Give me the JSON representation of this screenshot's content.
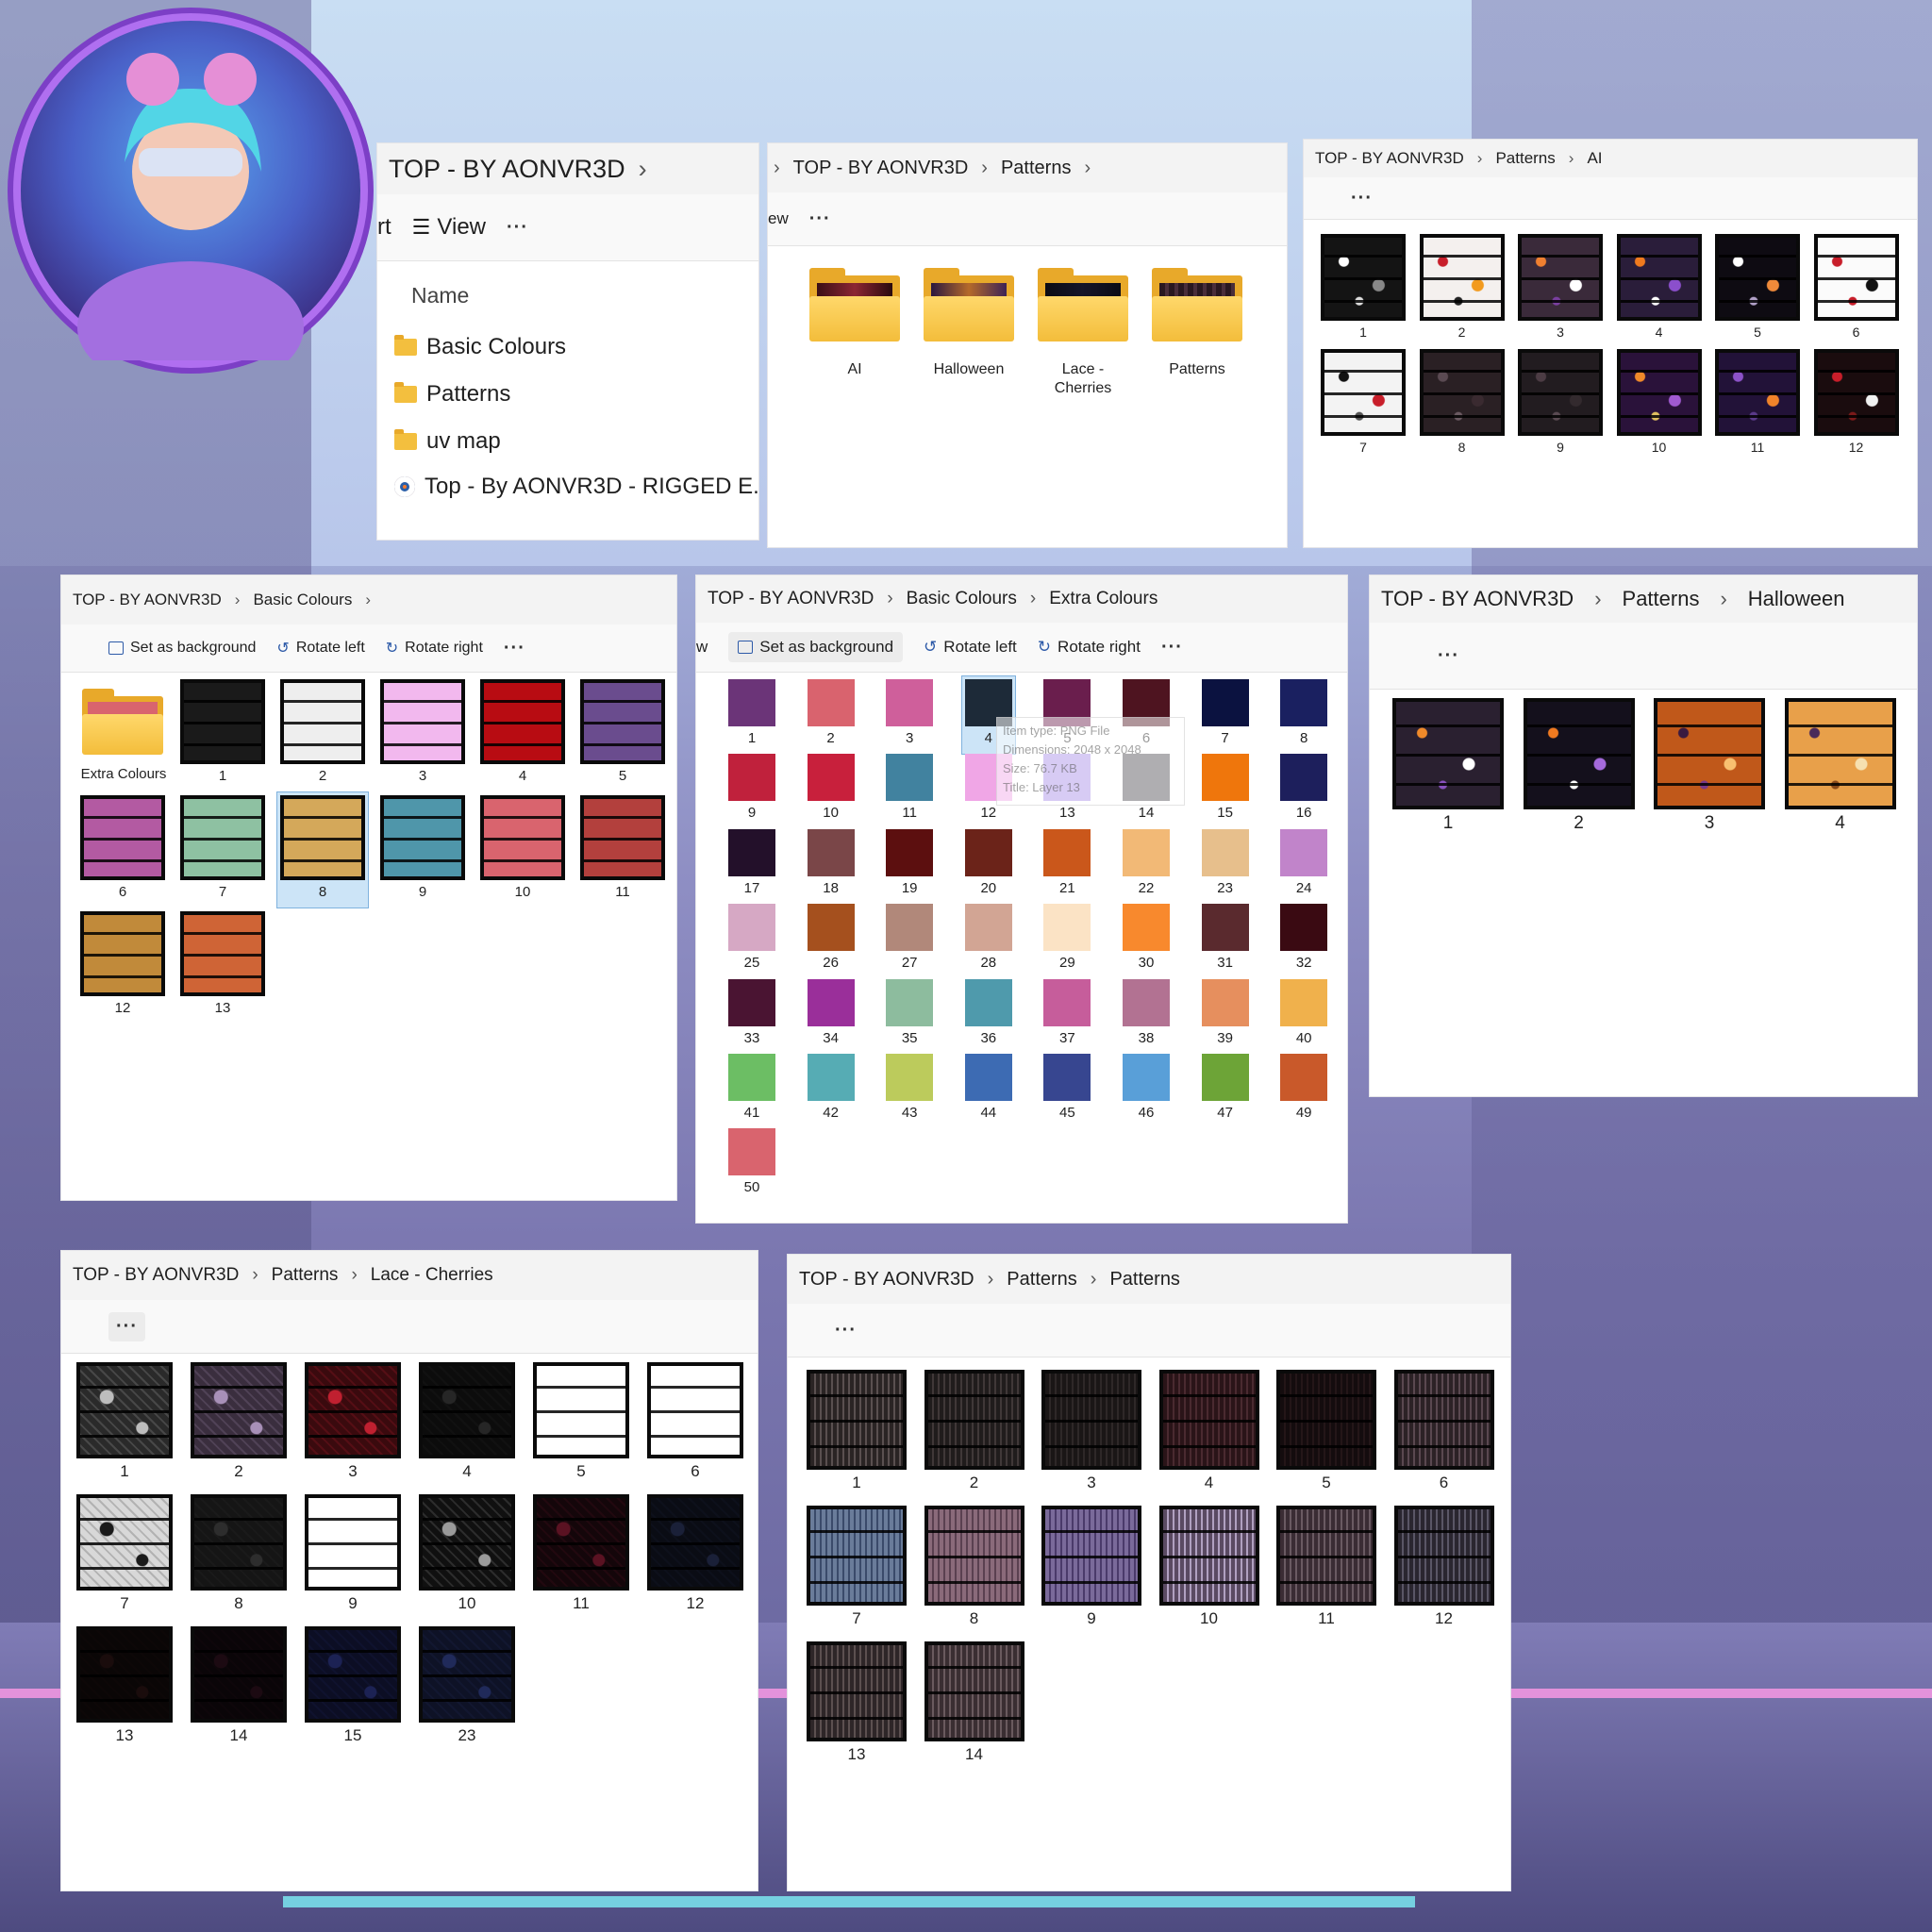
{
  "colors": {
    "basic": [
      "#1a1a1a",
      "#eeeeee",
      "#f2b8ee",
      "#b80c12",
      "#6a4c8e",
      "#b35aa2",
      "#8ec1a2",
      "#d4a85a",
      "#4f96aa",
      "#d9646e",
      "#b3403d",
      "#c18a3a",
      "#cf6436"
    ],
    "extra": [
      "#6b3478",
      "#d9636e",
      "#cf5f9b",
      "#1d2a38",
      "#6a1e4d",
      "#4e1420",
      "#0b1240",
      "#1a2060",
      "#c0213c",
      "#c8203c",
      "#41829f",
      "#f0a6e6",
      "#a68ce6",
      "#4f4c52",
      "#ef760c",
      "#1d1f5c",
      "#23102a",
      "#7a4648",
      "#5c0f0f",
      "#6b2319",
      "#ca571b",
      "#f2b976",
      "#e7bf8c",
      "#c184ca",
      "#d6a8c4",
      "#a5501e",
      "#b1887a",
      "#d2a594",
      "#fbe3c5",
      "#f8892d",
      "#5a2a2e",
      "#3a0a12",
      "#4a1432",
      "#9a2f9a",
      "#8dbc9e",
      "#4f9aac",
      "#c65d9b",
      "#b27292",
      "#e68f5e",
      "#f0b14c",
      "#6cbe64",
      "#56acb4",
      "#bccb5c",
      "#3d6bb3",
      "#374690",
      "#599fd8",
      "#6da437",
      "#c9592a",
      "#d9646e"
    ]
  },
  "root_window": {
    "breadcrumb": [
      "TOP - BY AONVR3D"
    ],
    "toolbar": {
      "sort": "rt",
      "view": "View",
      "more": "···"
    },
    "column_header": "Name",
    "items": [
      "Basic Colours",
      "Patterns",
      "uv map",
      "Top - By AONVR3D - RIGGED E..."
    ]
  },
  "patterns_window": {
    "breadcrumb": [
      "TOP - BY AONVR3D",
      "Patterns"
    ],
    "toolbar": {
      "view_partial": "ew",
      "more": "···"
    },
    "folders": [
      "AI",
      "Halloween",
      "Lace -\nCherries",
      "Patterns"
    ]
  },
  "ai_window": {
    "breadcrumb": [
      "TOP - BY AONVR3D",
      "Patterns",
      "AI"
    ],
    "toolbar": {
      "more": "···"
    },
    "labels": [
      "1",
      "2",
      "3",
      "4",
      "5",
      "6",
      "7",
      "8",
      "9",
      "10",
      "11",
      "12"
    ]
  },
  "basic_window": {
    "breadcrumb": [
      "TOP - BY AONVR3D",
      "Basic Colours"
    ],
    "toolbar": {
      "set_bg": "Set as background",
      "rotate_left": "Rotate left",
      "rotate_right": "Rotate right",
      "more": "···"
    },
    "folder_label": "Extra Colours",
    "labels": [
      "1",
      "2",
      "3",
      "4",
      "5",
      "6",
      "7",
      "8",
      "9",
      "10",
      "11",
      "12",
      "13"
    ],
    "selected": "8"
  },
  "extra_window": {
    "breadcrumb": [
      "TOP - BY AONVR3D",
      "Basic Colours",
      "Extra Colours"
    ],
    "toolbar": {
      "view_partial": "w",
      "set_bg": "Set as background",
      "rotate_left": "Rotate left",
      "rotate_right": "Rotate right",
      "more": "···"
    },
    "labels": [
      "1",
      "2",
      "3",
      "4",
      "5",
      "6",
      "7",
      "8",
      "9",
      "10",
      "11",
      "12",
      "13",
      "14",
      "15",
      "16",
      "17",
      "18",
      "19",
      "20",
      "21",
      "22",
      "23",
      "24",
      "25",
      "26",
      "27",
      "28",
      "29",
      "30",
      "31",
      "32",
      "33",
      "34",
      "35",
      "36",
      "37",
      "38",
      "39",
      "40",
      "41",
      "42",
      "43",
      "44",
      "45",
      "46",
      "47",
      "49",
      "50"
    ],
    "selected": "4",
    "tooltip": [
      "Item type: PNG File",
      "Dimensions: 2048 x 2048",
      "Size: 76.7 KB",
      "Title: Layer 13"
    ]
  },
  "halloween_window": {
    "breadcrumb": [
      "TOP - BY AONVR3D",
      "Patterns",
      "Halloween"
    ],
    "toolbar": {
      "more": "···"
    },
    "labels": [
      "1",
      "2",
      "3",
      "4"
    ]
  },
  "lace_window": {
    "breadcrumb": [
      "TOP - BY AONVR3D",
      "Patterns",
      "Lace - Cherries"
    ],
    "toolbar": {
      "more": "···"
    },
    "labels": [
      "1",
      "2",
      "3",
      "4",
      "5",
      "6",
      "7",
      "8",
      "9",
      "10",
      "11",
      "12",
      "13",
      "14",
      "15",
      "23"
    ]
  },
  "plaid_window": {
    "breadcrumb": [
      "TOP - BY AONVR3D",
      "Patterns",
      "Patterns"
    ],
    "toolbar": {
      "more": "···"
    },
    "labels": [
      "1",
      "2",
      "3",
      "4",
      "5",
      "6",
      "7",
      "8",
      "9",
      "10",
      "11",
      "12",
      "13",
      "14"
    ]
  }
}
